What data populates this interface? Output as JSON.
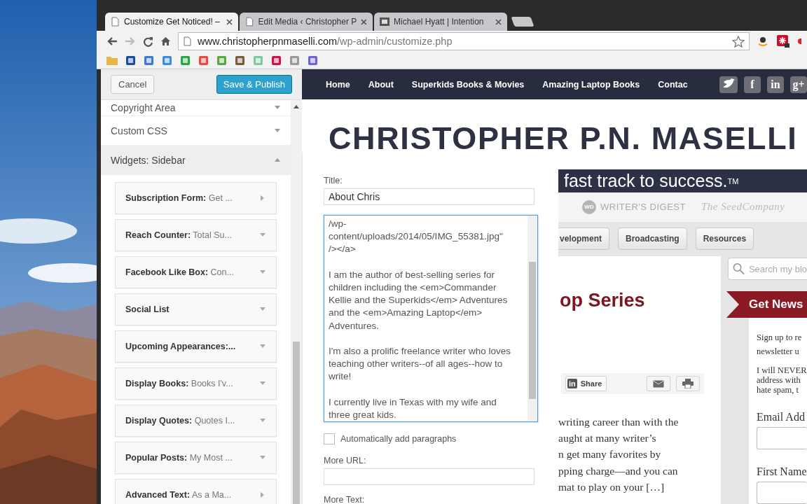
{
  "browser": {
    "tabs": [
      {
        "title": "Customize Get Noticed! –",
        "selected": true
      },
      {
        "title": "Edit Media ‹ Christopher P",
        "selected": false
      },
      {
        "title": "Michael Hyatt | Intention",
        "selected": false
      }
    ],
    "url_host": "www.christopherpnmaselli.com",
    "url_path": "/wp-admin/customize.php"
  },
  "customizer": {
    "cancel": "Cancel",
    "publish": "Save & Publish",
    "sections": [
      {
        "label": "Copyright Area",
        "expanded": false
      },
      {
        "label": "Custom CSS",
        "expanded": false
      },
      {
        "label": "Widgets: Sidebar",
        "expanded": true
      }
    ],
    "widgets": [
      {
        "name": "Subscription Form:",
        "detail": "Get ...",
        "kind": "right"
      },
      {
        "name": "Reach Counter:",
        "detail": "Total Su...",
        "kind": "down"
      },
      {
        "name": "Facebook Like Box:",
        "detail": "Con...",
        "kind": "down"
      },
      {
        "name": "Social List",
        "kind": "down"
      },
      {
        "name": "Upcoming Appearances:...",
        "kind": "down"
      },
      {
        "name": "Display Books:",
        "detail": "Books I'v...",
        "kind": "down"
      },
      {
        "name": "Display Quotes:",
        "detail": "Quotes I...",
        "kind": "down"
      },
      {
        "name": "Popular Posts:",
        "detail": "My Most ...",
        "kind": "down"
      },
      {
        "name": "Advanced Text:",
        "detail": "As a Ma...",
        "kind": "right"
      }
    ]
  },
  "widget_form": {
    "title_label": "Title:",
    "title_value": "About Chris",
    "body": "/wp-\ncontent/uploads/2014/05/IMG_55381.jpg\"\n/></a>\n\nI am the author of best-selling series for children including the <em>Commander Kellie and the Superkids</em> Adventures and the <em>Amazing Laptop</em> Adventures.\n\nI'm also a prolific freelance writer who loves teaching other writers--of all ages--how to write!\n\nI currently live in Texas with my wife and three great kids.",
    "autop": {
      "label": "Automatically add paragraphs",
      "checked": false
    },
    "more_url_label": "More URL:",
    "more_text_label": "More Text:"
  },
  "site": {
    "nav": [
      "Home",
      "About",
      "Superkids Books & Movies",
      "Amazing Laptop Books",
      "Contac"
    ],
    "social": [
      {
        "kind": "bird"
      },
      {
        "kind": "letter",
        "label": "f"
      },
      {
        "kind": "letter",
        "label": "in"
      },
      {
        "kind": "letter",
        "label": "g+"
      }
    ],
    "site_title": "CHRISTOPHER P.N. MASELLI",
    "tagline": "fast track to success.$^{TM}$",
    "logos": [
      {
        "badge": "WD",
        "text": "WRITER'S DIGEST"
      },
      {
        "text": "The SeedCompany"
      }
    ],
    "category_buttons": [
      "velopment",
      "Broadcasting",
      "Resources"
    ],
    "post_title": "op Series",
    "share": {
      "icon_label": "in",
      "label": "Share"
    },
    "excerpt": [
      "writing career than with the",
      "aught at many writer’s",
      "n get many favorites by",
      "pping charge—and you can",
      "mat to play on your […]"
    ],
    "search_placeholder": "Search my blo",
    "newsletter_title": "Get News",
    "newsletter_lines": [
      "Sign up to re",
      "newsletter u"
    ],
    "spam_lines": [
      "I will NEVER",
      "address with",
      "hate spam, t"
    ],
    "email_label": "Email Add",
    "first_name_label": "First Name"
  }
}
